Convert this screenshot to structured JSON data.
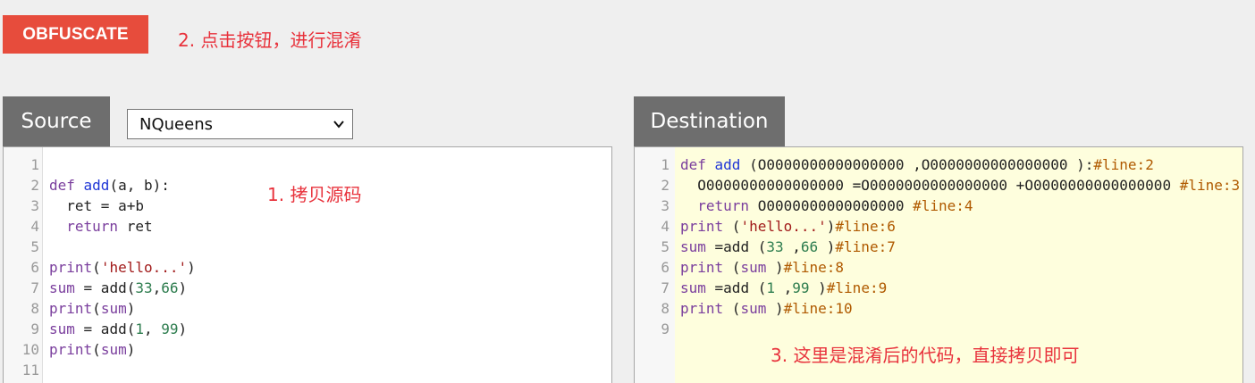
{
  "toolbar": {
    "obfuscate_label": "OBFUSCATE"
  },
  "annotations": {
    "step2": "2. 点击按钮，进行混淆",
    "step1": "1. 拷贝源码",
    "step3": "3. 这里是混淆后的代码，直接拷贝即可"
  },
  "source": {
    "tab_label": "Source",
    "example_select": {
      "selected": "NQueens"
    },
    "lines": [
      {
        "n": "1",
        "parts": []
      },
      {
        "n": "2",
        "parts": [
          {
            "t": "def ",
            "c": "kw"
          },
          {
            "t": "add",
            "c": "fn"
          },
          {
            "t": "(a, b):",
            "c": "id"
          }
        ]
      },
      {
        "n": "3",
        "parts": [
          {
            "t": "  ret = a+b",
            "c": "id"
          }
        ]
      },
      {
        "n": "4",
        "parts": [
          {
            "t": "  ",
            "c": "id"
          },
          {
            "t": "return",
            "c": "kw"
          },
          {
            "t": " ret",
            "c": "id"
          }
        ]
      },
      {
        "n": "5",
        "parts": []
      },
      {
        "n": "6",
        "parts": [
          {
            "t": "print",
            "c": "kw"
          },
          {
            "t": "(",
            "c": "id"
          },
          {
            "t": "'hello...'",
            "c": "str"
          },
          {
            "t": ")",
            "c": "id"
          }
        ]
      },
      {
        "n": "7",
        "parts": [
          {
            "t": "sum",
            "c": "kw"
          },
          {
            "t": " = add(",
            "c": "id"
          },
          {
            "t": "33",
            "c": "num"
          },
          {
            "t": ",",
            "c": "id"
          },
          {
            "t": "66",
            "c": "num"
          },
          {
            "t": ")",
            "c": "id"
          }
        ]
      },
      {
        "n": "8",
        "parts": [
          {
            "t": "print",
            "c": "kw"
          },
          {
            "t": "(",
            "c": "id"
          },
          {
            "t": "sum",
            "c": "kw"
          },
          {
            "t": ")",
            "c": "id"
          }
        ]
      },
      {
        "n": "9",
        "parts": [
          {
            "t": "sum",
            "c": "kw"
          },
          {
            "t": " = add(",
            "c": "id"
          },
          {
            "t": "1",
            "c": "num"
          },
          {
            "t": ", ",
            "c": "id"
          },
          {
            "t": "99",
            "c": "num"
          },
          {
            "t": ")",
            "c": "id"
          }
        ]
      },
      {
        "n": "10",
        "parts": [
          {
            "t": "print",
            "c": "kw"
          },
          {
            "t": "(",
            "c": "id"
          },
          {
            "t": "sum",
            "c": "kw"
          },
          {
            "t": ")",
            "c": "id"
          }
        ]
      },
      {
        "n": "11",
        "parts": []
      }
    ]
  },
  "destination": {
    "tab_label": "Destination",
    "lines": [
      {
        "n": "1",
        "parts": [
          {
            "t": "def ",
            "c": "kw"
          },
          {
            "t": "add",
            "c": "fn"
          },
          {
            "t": " (O0000000000000000 ,O0000000000000000 ):",
            "c": "id"
          },
          {
            "t": "#line:2",
            "c": "cmt"
          }
        ]
      },
      {
        "n": "2",
        "parts": [
          {
            "t": "  O0000000000000000 =O0000000000000000 +O0000000000000000 ",
            "c": "id"
          },
          {
            "t": "#line:3",
            "c": "cmt"
          }
        ]
      },
      {
        "n": "3",
        "parts": [
          {
            "t": "  ",
            "c": "id"
          },
          {
            "t": "return",
            "c": "kw"
          },
          {
            "t": " O0000000000000000 ",
            "c": "id"
          },
          {
            "t": "#line:4",
            "c": "cmt"
          }
        ]
      },
      {
        "n": "4",
        "parts": [
          {
            "t": "print",
            "c": "kw"
          },
          {
            "t": " (",
            "c": "id"
          },
          {
            "t": "'hello...'",
            "c": "str"
          },
          {
            "t": ")",
            "c": "id"
          },
          {
            "t": "#line:6",
            "c": "cmt"
          }
        ]
      },
      {
        "n": "5",
        "parts": [
          {
            "t": "sum",
            "c": "kw"
          },
          {
            "t": " =add (",
            "c": "id"
          },
          {
            "t": "33",
            "c": "num"
          },
          {
            "t": " ,",
            "c": "id"
          },
          {
            "t": "66",
            "c": "num"
          },
          {
            "t": " )",
            "c": "id"
          },
          {
            "t": "#line:7",
            "c": "cmt"
          }
        ]
      },
      {
        "n": "6",
        "parts": [
          {
            "t": "print",
            "c": "kw"
          },
          {
            "t": " (",
            "c": "id"
          },
          {
            "t": "sum",
            "c": "kw"
          },
          {
            "t": " )",
            "c": "id"
          },
          {
            "t": "#line:8",
            "c": "cmt"
          }
        ]
      },
      {
        "n": "7",
        "parts": [
          {
            "t": "sum",
            "c": "kw"
          },
          {
            "t": " =add (",
            "c": "id"
          },
          {
            "t": "1",
            "c": "num"
          },
          {
            "t": " ,",
            "c": "id"
          },
          {
            "t": "99",
            "c": "num"
          },
          {
            "t": " )",
            "c": "id"
          },
          {
            "t": "#line:9",
            "c": "cmt"
          }
        ]
      },
      {
        "n": "8",
        "parts": [
          {
            "t": "print",
            "c": "kw"
          },
          {
            "t": " (",
            "c": "id"
          },
          {
            "t": "sum",
            "c": "kw"
          },
          {
            "t": " )",
            "c": "id"
          },
          {
            "t": "#line:10",
            "c": "cmt"
          }
        ]
      },
      {
        "n": "9",
        "parts": []
      }
    ]
  },
  "colors": {
    "button_bg": "#e74c3c",
    "annotation": "#e8323c",
    "tab_bg": "#6e6e6e",
    "destination_bg": "#fefedd"
  }
}
